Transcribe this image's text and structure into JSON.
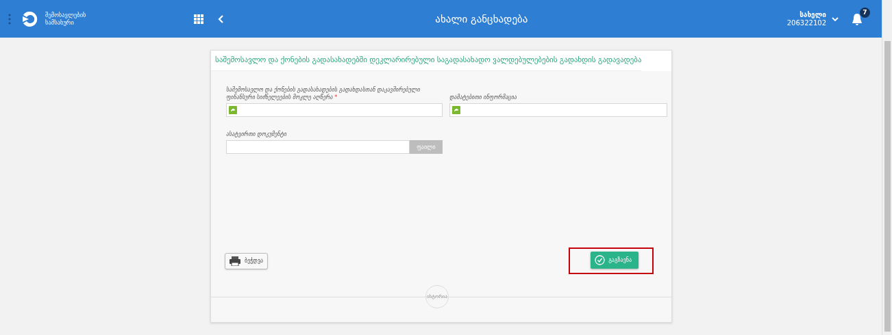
{
  "header": {
    "logo_text": [
      "შემოსავლების",
      "სამსახური"
    ],
    "title": "ახალი განცხადება",
    "user": {
      "name": "სახელი",
      "id": "206322102"
    },
    "notifications": {
      "count": "7"
    }
  },
  "form": {
    "title": "საშემოსავლო და ქონების გადასახადებში დეკლარირებული საგადასახადო ვალდებულებების გადახდის გადავადება",
    "fields": [
      {
        "kind": "text",
        "label": "საშემოსავლო და ქონების გადასახადების გადახდასთან დაკავშირებული ფინანსური სიძნელეების მოკლე აღწერა",
        "required_mark": "*"
      },
      {
        "kind": "text",
        "label": "დამატებითი ინფორმაცია"
      },
      {
        "kind": "file",
        "label": "ასატვირთი დოკუმენტი",
        "button": "ფაილი"
      }
    ],
    "print_button": "ბეჭდვა",
    "submit_button": "გაგზავნა",
    "submit_highlighted": true,
    "history_button": "ისტორია"
  }
}
